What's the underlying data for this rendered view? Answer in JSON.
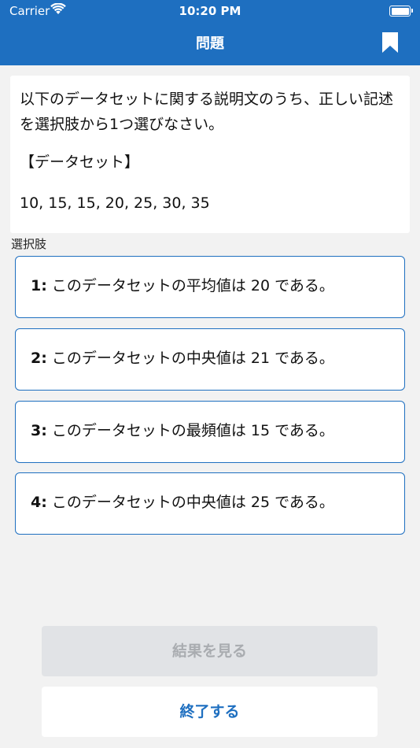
{
  "status_bar": {
    "carrier": "Carrier",
    "time": "10:20 PM"
  },
  "nav": {
    "title": "問題",
    "accent_color": "#1e6fc0"
  },
  "question": {
    "text": "以下のデータセットに関する説明文のうち、正しい記述を選択肢から1つ選びなさい。",
    "dataset_heading": "【データセット】",
    "dataset_values": "10, 15, 15, 20, 25, 30, 35"
  },
  "choices_label": "選択肢",
  "choices": [
    {
      "num": "1:",
      "text": "このデータセットの平均値は 20 である。"
    },
    {
      "num": "2:",
      "text": "このデータセットの中央値は 21 である。"
    },
    {
      "num": "3:",
      "text": "このデータセットの最頻値は 15 である。"
    },
    {
      "num": "4:",
      "text": "このデータセットの中央値は 25 である。"
    }
  ],
  "buttons": {
    "show_result": "結果を見る",
    "finish": "終了する"
  },
  "icons": {
    "wifi": "wifi-icon",
    "battery": "battery-icon",
    "bookmark": "bookmark-icon"
  }
}
